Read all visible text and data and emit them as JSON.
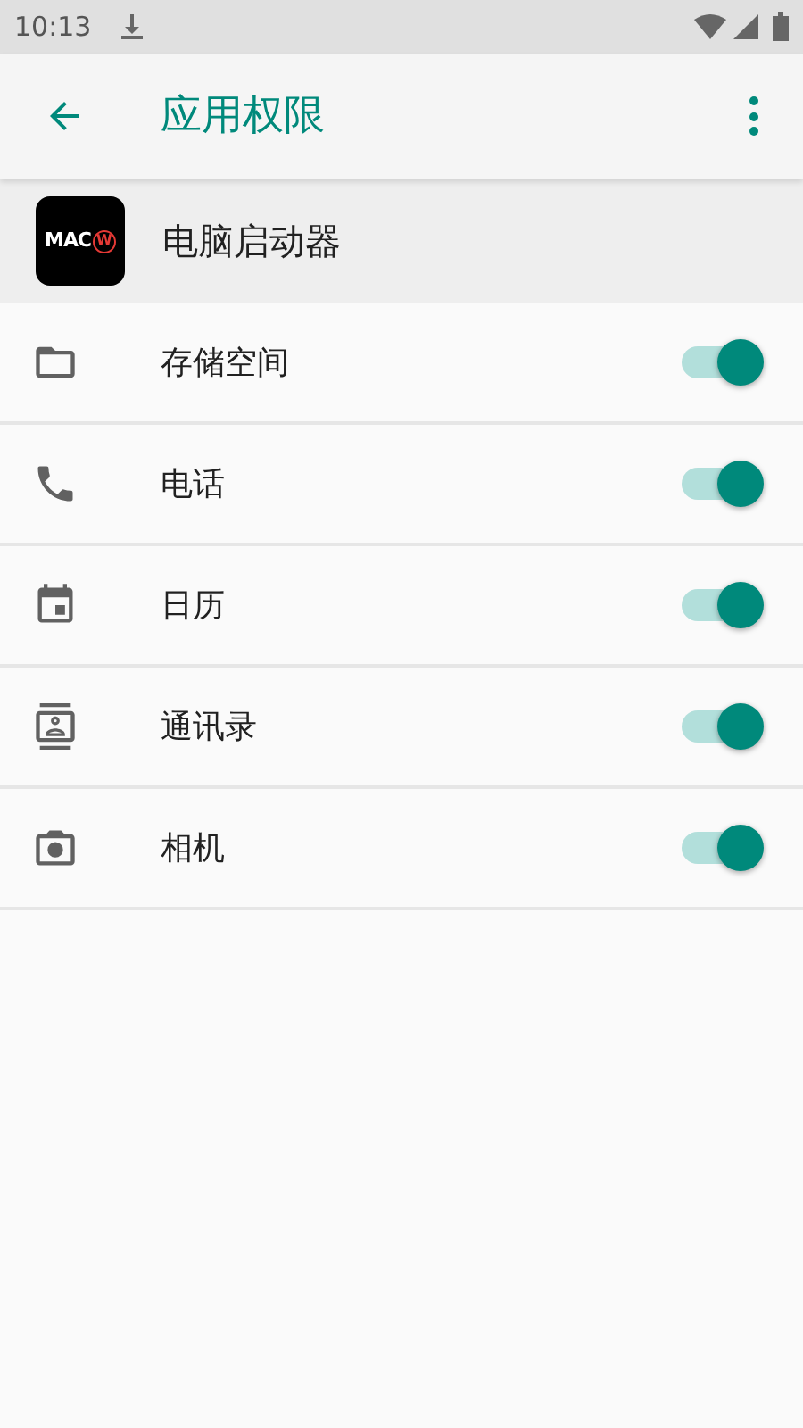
{
  "status_bar": {
    "time": "10:13"
  },
  "toolbar": {
    "title": "应用权限"
  },
  "app": {
    "name": "电脑启动器",
    "logo_text": "MAC",
    "logo_mark": "W"
  },
  "permissions": [
    {
      "kind": "folder",
      "label": "存储空间",
      "on": true
    },
    {
      "kind": "phone",
      "label": "电话",
      "on": true
    },
    {
      "kind": "calendar",
      "label": "日历",
      "on": true
    },
    {
      "kind": "contacts",
      "label": "通讯录",
      "on": true
    },
    {
      "kind": "camera",
      "label": "相机",
      "on": true
    }
  ]
}
